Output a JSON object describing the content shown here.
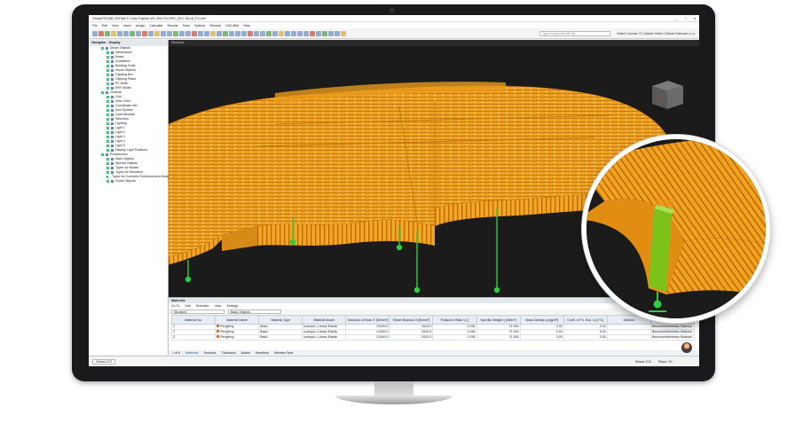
{
  "window": {
    "title": "Global RSTAB | RSTAB 9 | Osio Pavilion WY-JEN OV-RSS_2017-08-18_PS.rs9*",
    "controls": [
      "–",
      "□",
      "✕"
    ]
  },
  "menu": [
    "File",
    "Edit",
    "View",
    "Insert",
    "Assign",
    "Calculate",
    "Results",
    "Tools",
    "Options",
    "Window",
    "CAD-BIM",
    "Help"
  ],
  "toolbar": {
    "search_placeholder": "Type a keyword (Alt+Q)",
    "license": "Online License 70 | Martin Heller | Dlubal Software s.r.o."
  },
  "navigator": {
    "title": "Navigator - Display",
    "items": [
      "Model Objects",
      "Dimensions",
      "Notes",
      "Guidelines",
      "Building Grids",
      "Visual Objects",
      "Clipping Box",
      "Clipping Plane",
      "FE Mesh",
      "ERF Model",
      "General",
      "Grid",
      "View Cube",
      "Coordinate Info",
      "Axis System",
      "Load Wizards",
      "Selection",
      "Lighting",
      "Light 1",
      "Light 2",
      "Light 3",
      "Light 4",
      "Light 5",
      "Display Light Positions",
      "Preselection",
      "Main Objects",
      "Special Objects",
      "Types for Nodes",
      "Types for Members",
      "Types for Concrete Reinforcement Design",
      "Guide Objects"
    ]
  },
  "view": {
    "label": "Windows"
  },
  "materials_table": {
    "title": "Materials",
    "menu": [
      "Go To",
      "Edit",
      "Selection",
      "View",
      "Settings"
    ],
    "filter": "Structure",
    "object_filter": "Basic Objects",
    "columns": [
      "Material No.",
      "Material Name",
      "Material Type",
      "Material Model",
      "Modulus of Elast. E [N/mm²]",
      "Shear Modulus G [N/mm²]",
      "Poisson's Ratio v [-]",
      "Specific Weight γ [kN/m³]",
      "Mass Density ρ [kg/m³]",
      "Coeff. of Th. Exp. α [1/°C]",
      "Options",
      "Comment"
    ],
    "rows": [
      [
        "1",
        "Pengfeng",
        "Basic",
        "Isotropic | Linear Elastic",
        "21000.0",
        "8100.0",
        "0.296",
        "71.900",
        "0.00",
        "0.00",
        "",
        "Benutzerdefiniertes Material"
      ],
      [
        "2",
        "Pengfeng",
        "Basic",
        "Isotropic | Linear Elastic",
        "21000.0",
        "8100.0",
        "0.296",
        "71.900",
        "0.00",
        "0.00",
        "",
        "Benutzerdefiniertes Material"
      ],
      [
        "3",
        "Pengfeng",
        "Basic",
        "Isotropic | Linear Elastic",
        "21000.0",
        "8100.0",
        "0.296",
        "71.900",
        "0.00",
        "0.00",
        "",
        "Benutzerdefiniertes Material"
      ]
    ],
    "pager": "1 of 6",
    "tabs": [
      "Materials",
      "Sections",
      "Thickness",
      "Nodes",
      "Members",
      "Member Sets"
    ]
  },
  "status": {
    "cs": "Global XYZ",
    "right_cs": "Global XYZ",
    "plane": "Plane: XY"
  },
  "colors": {
    "timber": "#f5a623",
    "timber_dark": "#c57a0e",
    "support": "#2ecc40",
    "background": "#1b1b1b"
  }
}
